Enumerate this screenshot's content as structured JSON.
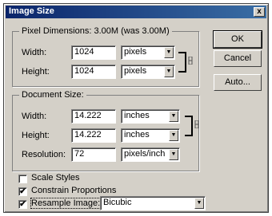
{
  "window": {
    "title": "Image Size",
    "close_glyph": "x"
  },
  "pixel_dimensions": {
    "label": "Pixel Dimensions:  3.00M (was 3.00M)",
    "width": {
      "label": "Width:",
      "value": "1024",
      "unit": "pixels"
    },
    "height": {
      "label": "Height:",
      "value": "1024",
      "unit": "pixels"
    }
  },
  "document_size": {
    "label": "Document Size:",
    "width": {
      "label": "Width:",
      "value": "14.222",
      "unit": "inches"
    },
    "height": {
      "label": "Height:",
      "value": "14.222",
      "unit": "inches"
    },
    "resolution": {
      "label": "Resolution:",
      "value": "72",
      "unit": "pixels/inch"
    }
  },
  "buttons": {
    "ok": "OK",
    "cancel": "Cancel",
    "auto": "Auto..."
  },
  "options": {
    "scale_styles": {
      "label": "Scale Styles",
      "checked": false
    },
    "constrain": {
      "label": "Constrain Proportions",
      "checked": true
    },
    "resample": {
      "label": "Resample Image:",
      "checked": true,
      "method": "Bicubic"
    }
  },
  "check_glyph": "✔",
  "arrow_glyph": "▼"
}
